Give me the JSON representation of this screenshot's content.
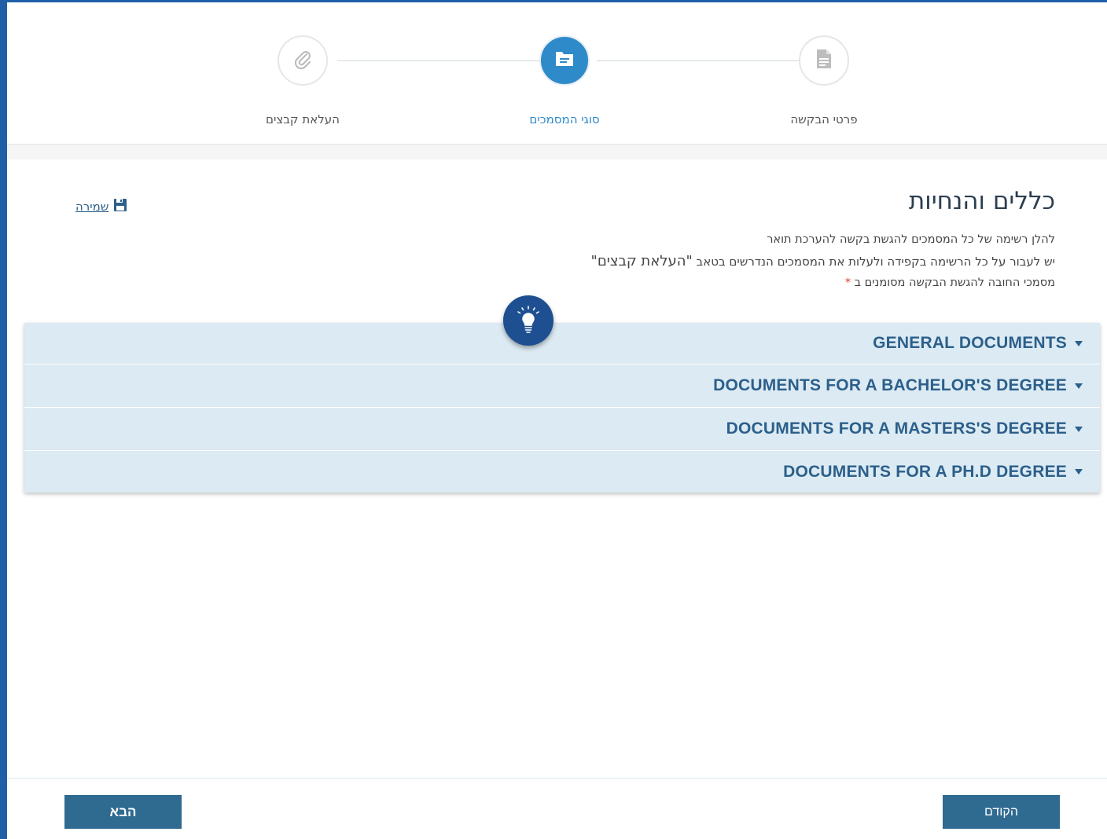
{
  "stepper": {
    "steps": [
      {
        "label": "העלאת קבצים",
        "icon": "paperclip-icon",
        "state": "inactive"
      },
      {
        "label": "סוגי המסמכים",
        "icon": "folder-icon",
        "state": "active"
      },
      {
        "label": "פרטי הבקשה",
        "icon": "document-icon",
        "state": "inactive"
      }
    ]
  },
  "header": {
    "title": "כללים והנחיות",
    "save_label": "שמירה",
    "save_icon": "floppy-disk-icon"
  },
  "instructions": {
    "line1": "להלן רשימה של כל המסמכים להגשת בקשה להערכת תואר",
    "line2_prefix": "יש לעבור על כל הרשימה בקפידה ולעלות את המסמכים הנדרשים בטאב ",
    "line2_quote": "\"העלאת קבצים\"",
    "line3": "מסמכי החובה להגשת הבקשה מסומנים ב ",
    "required_marker": "*"
  },
  "tip_icon": "lightbulb-icon",
  "accordion": {
    "items": [
      {
        "label": "GENERAL DOCUMENTS"
      },
      {
        "label": "DOCUMENTS FOR A BACHELOR'S DEGREE"
      },
      {
        "label": "DOCUMENTS FOR A MASTERS'S DEGREE"
      },
      {
        "label": "DOCUMENTS FOR A PH.D DEGREE"
      }
    ]
  },
  "footer": {
    "next_label": "הבא",
    "prev_label": "הקודם"
  },
  "colors": {
    "frame": "#1f5fa8",
    "accent": "#2f8ac9",
    "accordion_bg": "#dbeaf3",
    "accordion_text": "#2c5f8a",
    "button_bg": "#2f6a91",
    "required": "#e53935"
  }
}
